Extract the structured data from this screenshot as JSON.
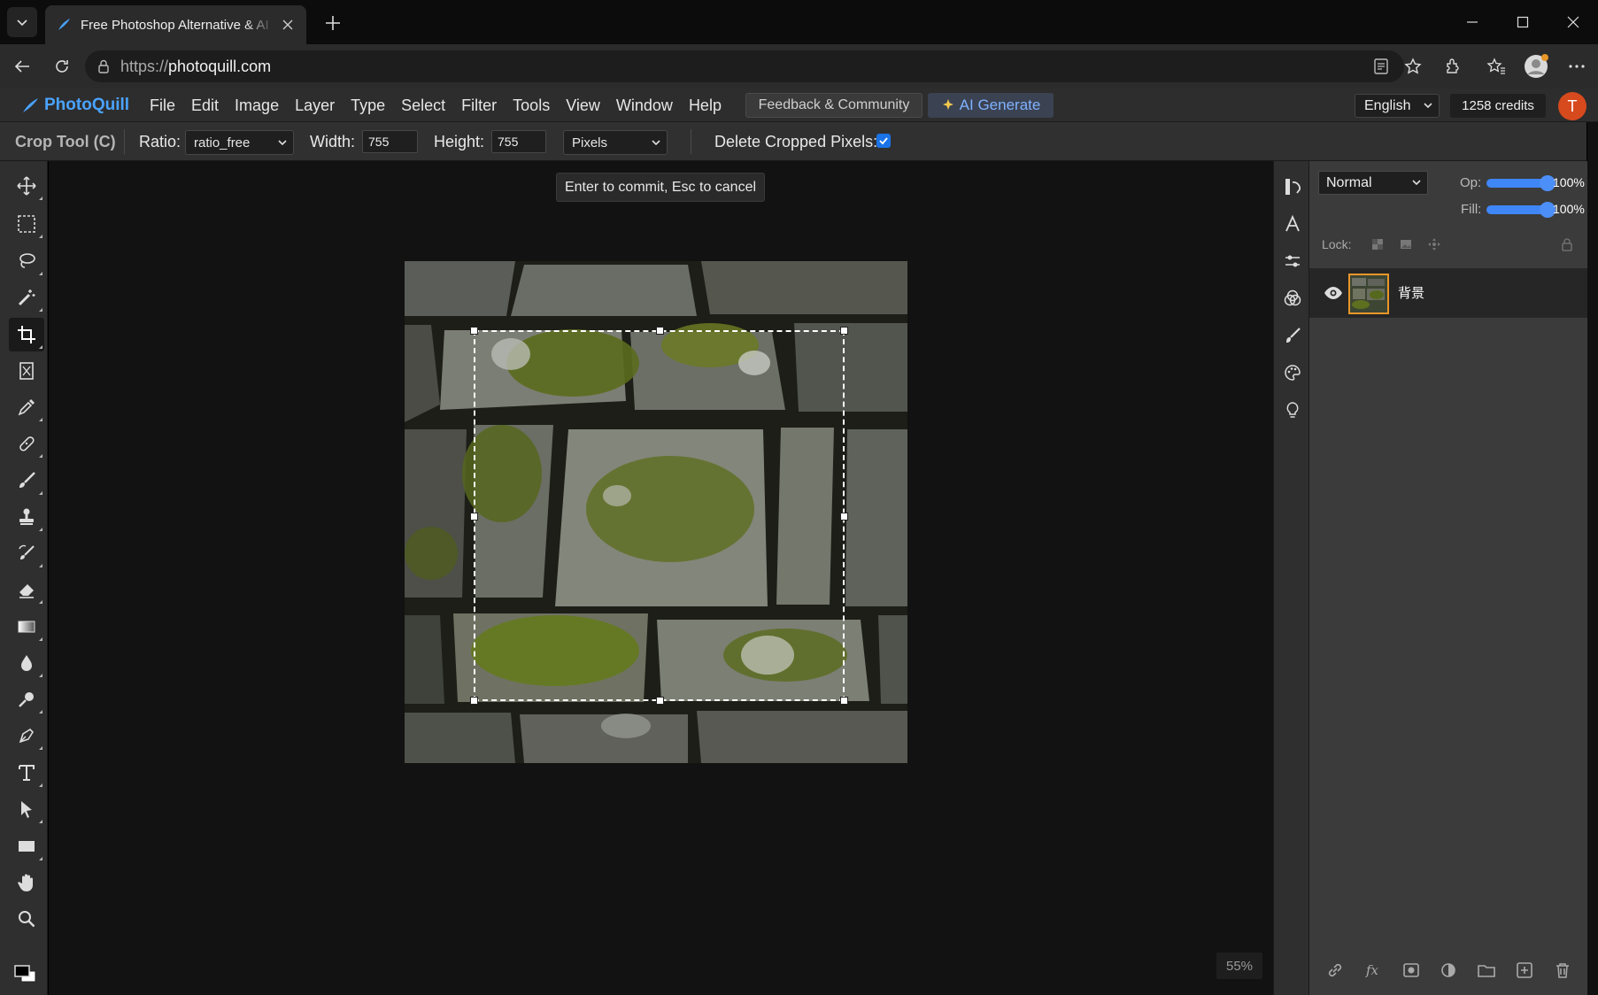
{
  "browser": {
    "tab_title": "Free Photoshop Alternative & AI Photo Editor",
    "url_protocol": "https://",
    "url_host": "photoquill.com"
  },
  "app": {
    "brand": "PhotoQuill",
    "menu": [
      "File",
      "Edit",
      "Image",
      "Layer",
      "Type",
      "Select",
      "Filter",
      "Tools",
      "View",
      "Window",
      "Help"
    ],
    "feedback_label": "Feedback & Community",
    "ai_label": "AI Generate",
    "language": "English",
    "credits": "1258 credits",
    "avatar_initial": "T"
  },
  "options": {
    "tool_name": "Crop Tool (C)",
    "ratio_label": "Ratio:",
    "ratio_value": "ratio_free",
    "width_label": "Width:",
    "width_value": "755",
    "height_label": "Height:",
    "height_value": "755",
    "unit_value": "Pixels",
    "delete_label": "Delete Cropped Pixels:",
    "delete_checked": true
  },
  "canvas": {
    "tooltip": "Enter to commit, Esc to cancel",
    "zoom": "55%"
  },
  "layers": {
    "blend_mode": "Normal",
    "opacity_label": "Op:",
    "opacity_value": "100%",
    "opacity_fraction": 1.0,
    "fill_label": "Fill:",
    "fill_value": "100%",
    "fill_fraction": 1.0,
    "lock_label": "Lock:",
    "items": [
      {
        "name": "背景",
        "visible": true
      }
    ]
  },
  "colors": {
    "accent": "#3f86f7",
    "brand": "#4aa3ff",
    "avatar": "#d64a1e",
    "layer_selection": "#e8962a"
  }
}
